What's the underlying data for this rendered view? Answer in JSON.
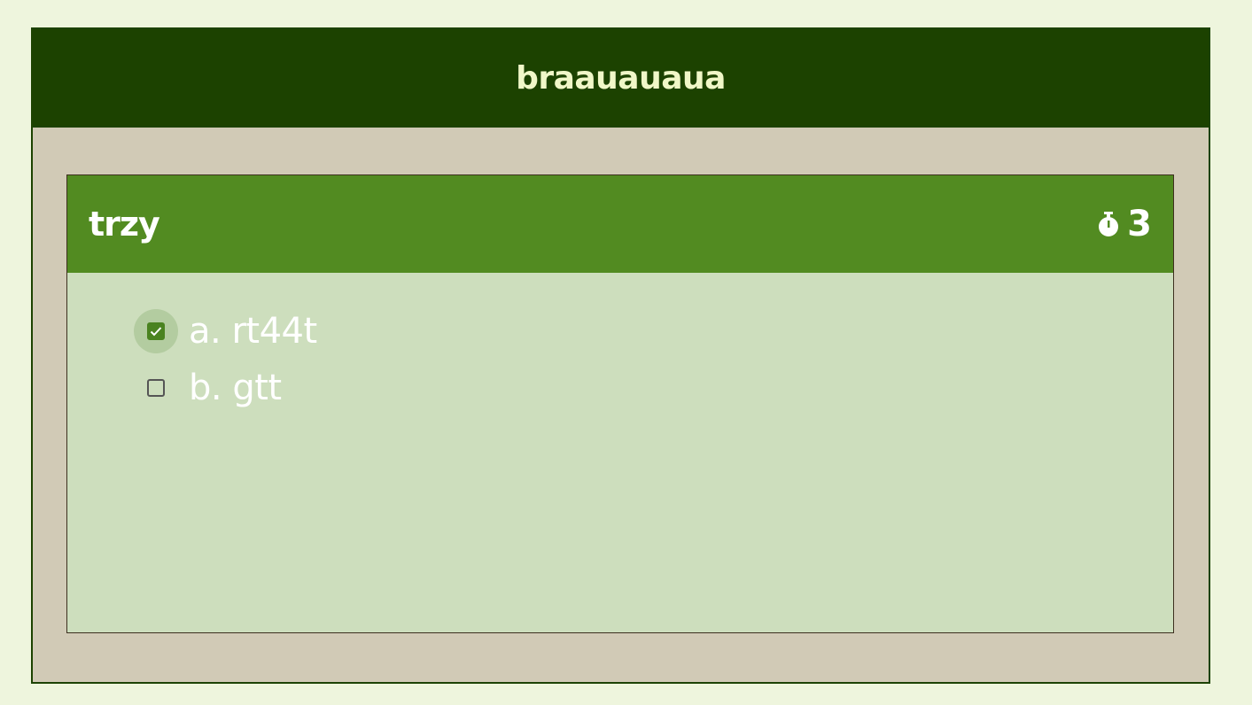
{
  "header": {
    "title": "braauauaua"
  },
  "question": {
    "title": "trzy",
    "timer_icon": "stopwatch-icon",
    "timer_value": "3",
    "options": [
      {
        "label": "a. rt44t",
        "checked": true
      },
      {
        "label": "b. gtt",
        "checked": false
      }
    ]
  },
  "colors": {
    "background": "#eef5dd",
    "topbar": "#1c4200",
    "frame": "#d1cab6",
    "card_header": "#528b21",
    "card_body": "#cddebd",
    "checkbox_checked": "#4a8320"
  }
}
